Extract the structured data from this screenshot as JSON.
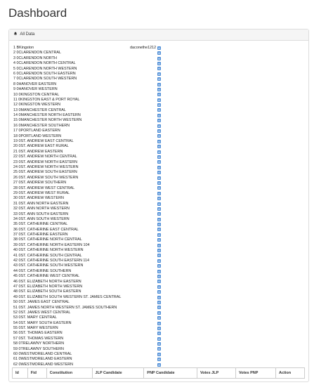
{
  "page_title": "Dashboard",
  "panel": {
    "heading": "All Data"
  },
  "rows": [
    {
      "num": "1",
      "name": "BKingston",
      "user": "daconethe1212"
    },
    {
      "num": "2",
      "name": "0CLARENDON CENTRAL",
      "user": ""
    },
    {
      "num": "3",
      "name": "0CLARENDON NORTH",
      "user": ""
    },
    {
      "num": "4",
      "name": "0CLARENDON NORTH CENTRAL",
      "user": ""
    },
    {
      "num": "5",
      "name": "0CLARENDON NORTH WESTERN",
      "user": ""
    },
    {
      "num": "6",
      "name": "0CLARENDON SOUTH EASTERN",
      "user": ""
    },
    {
      "num": "7",
      "name": "0CLARENDON SOUTH WESTERN",
      "user": ""
    },
    {
      "num": "8",
      "name": "0HANOVER EASTERN",
      "user": ""
    },
    {
      "num": "9",
      "name": "0HANOVER WESTERN",
      "user": ""
    },
    {
      "num": "10",
      "name": "0KINGSTON CENTRAL",
      "user": ""
    },
    {
      "num": "11",
      "name": "0KINGSTON EAST & PORT ROYAL",
      "user": ""
    },
    {
      "num": "12",
      "name": "0KINGSTON WESTERN",
      "user": ""
    },
    {
      "num": "13",
      "name": "0MANCHESTER CENTRAL",
      "user": ""
    },
    {
      "num": "14",
      "name": "0MANCHESTER NORTH EASTERN",
      "user": ""
    },
    {
      "num": "15",
      "name": "0MANCHESTER NORTH WESTERN",
      "user": ""
    },
    {
      "num": "16",
      "name": "0MANCHESTER SOUTHERN",
      "user": ""
    },
    {
      "num": "17",
      "name": "0PORTLAND EASTERN",
      "user": ""
    },
    {
      "num": "18",
      "name": "0PORTLAND WESTERN",
      "user": ""
    },
    {
      "num": "19",
      "name": "0ST. ANDREW EAST CENTRAL",
      "user": ""
    },
    {
      "num": "20",
      "name": "0ST. ANDREW EAST RURAL",
      "user": ""
    },
    {
      "num": "21",
      "name": "0ST. ANDREW EASTERN",
      "user": ""
    },
    {
      "num": "22",
      "name": "0ST. ANDREW NORTH CENTRAL",
      "user": ""
    },
    {
      "num": "23",
      "name": "0ST. ANDREW NORTH EASTERN",
      "user": ""
    },
    {
      "num": "24",
      "name": "0ST. ANDREW NORTH WESTERN",
      "user": ""
    },
    {
      "num": "25",
      "name": "0ST. ANDREW SOUTH EASTERN",
      "user": ""
    },
    {
      "num": "26",
      "name": "0ST. ANDREW SOUTH WESTERN",
      "user": ""
    },
    {
      "num": "27",
      "name": "0ST. ANDREW SOUTHERN",
      "user": ""
    },
    {
      "num": "28",
      "name": "0ST. ANDREW WEST CENTRAL",
      "user": ""
    },
    {
      "num": "29",
      "name": "0ST. ANDREW WEST RURAL",
      "user": ""
    },
    {
      "num": "30",
      "name": "0ST. ANDREW WESTERN",
      "user": ""
    },
    {
      "num": "31",
      "name": "0ST. ANN NORTH EASTERN",
      "user": ""
    },
    {
      "num": "32",
      "name": "0ST. ANN NORTH WESTERN",
      "user": ""
    },
    {
      "num": "33",
      "name": "0ST. ANN SOUTH EASTERN",
      "user": ""
    },
    {
      "num": "34",
      "name": "0ST. ANN SOUTH WESTERN",
      "user": ""
    },
    {
      "num": "35",
      "name": "0ST. CATHERINE CENTRAL",
      "user": ""
    },
    {
      "num": "36",
      "name": "0ST. CATHERINE EAST CENTRAL",
      "user": ""
    },
    {
      "num": "37",
      "name": "0ST. CATHERINE EASTERN",
      "user": ""
    },
    {
      "num": "38",
      "name": "0ST. CATHERINE NORTH CENTRAL",
      "user": ""
    },
    {
      "num": "39",
      "name": "0ST. CATHERINE NORTH EASTERN 104",
      "user": ""
    },
    {
      "num": "40",
      "name": "0ST. CATHERINE NORTH WESTERN",
      "user": ""
    },
    {
      "num": "41",
      "name": "0ST. CATHERINE SOUTH CENTRAL",
      "user": ""
    },
    {
      "num": "42",
      "name": "0ST. CATHERINE SOUTH EASTERN 114",
      "user": ""
    },
    {
      "num": "43",
      "name": "0ST. CATHERINE SOUTH WESTERN",
      "user": ""
    },
    {
      "num": "44",
      "name": "0ST. CATHERINE SOUTHERN",
      "user": ""
    },
    {
      "num": "45",
      "name": "0ST. CATHERINE WEST CENTRAL",
      "user": ""
    },
    {
      "num": "46",
      "name": "0ST. ELIZABETH NORTH EASTERN",
      "user": ""
    },
    {
      "num": "47",
      "name": "0ST. ELIZABETH NORTH WESTERN",
      "user": ""
    },
    {
      "num": "48",
      "name": "0ST. ELIZABETH SOUTH EASTERN",
      "user": ""
    },
    {
      "num": "49",
      "name": "0ST. ELIZABETH SOUTH WESTERN ST. JAMES CENTRAL",
      "user": ""
    },
    {
      "num": "50",
      "name": "0ST. JAMES EAST CENTRAL",
      "user": ""
    },
    {
      "num": "51",
      "name": "0ST. JAMES NORTH WESTERN ST. JAMES SOUTHERN",
      "user": ""
    },
    {
      "num": "52",
      "name": "0ST. JAMES WEST CENTRAL",
      "user": ""
    },
    {
      "num": "53",
      "name": "0ST. MARY CENTRAL",
      "user": ""
    },
    {
      "num": "54",
      "name": "0ST. MARY SOUTH EASTERN",
      "user": ""
    },
    {
      "num": "55",
      "name": "0ST. MARY WESTERN",
      "user": ""
    },
    {
      "num": "56",
      "name": "0ST. THOMAS EASTERN",
      "user": ""
    },
    {
      "num": "57",
      "name": "0ST. THOMAS WESTERN",
      "user": ""
    },
    {
      "num": "58",
      "name": "0TRELAWNY NORTHERN",
      "user": ""
    },
    {
      "num": "59",
      "name": "0TRELAWNY SOUTHERN",
      "user": ""
    },
    {
      "num": "60",
      "name": "0WESTMORELAND CENTRAL",
      "user": ""
    },
    {
      "num": "61",
      "name": "0WESTMORELAND EASTERN",
      "user": ""
    },
    {
      "num": "62",
      "name": "0WESTMORELAND WESTERN",
      "user": ""
    }
  ],
  "table": {
    "columns": [
      "Id",
      "Fid",
      "Constitution",
      "JLP Candidate",
      "PNP Candidate",
      "Votes JLP",
      "Votes PNP",
      "Action"
    ]
  },
  "icons": {
    "heading_icon": "bell-icon",
    "row_icon": "g-icon"
  },
  "colors": {
    "g_icon": "#4a8bd6",
    "panel_heading_bg": "#f5f5f5",
    "border": "#dddddd"
  }
}
